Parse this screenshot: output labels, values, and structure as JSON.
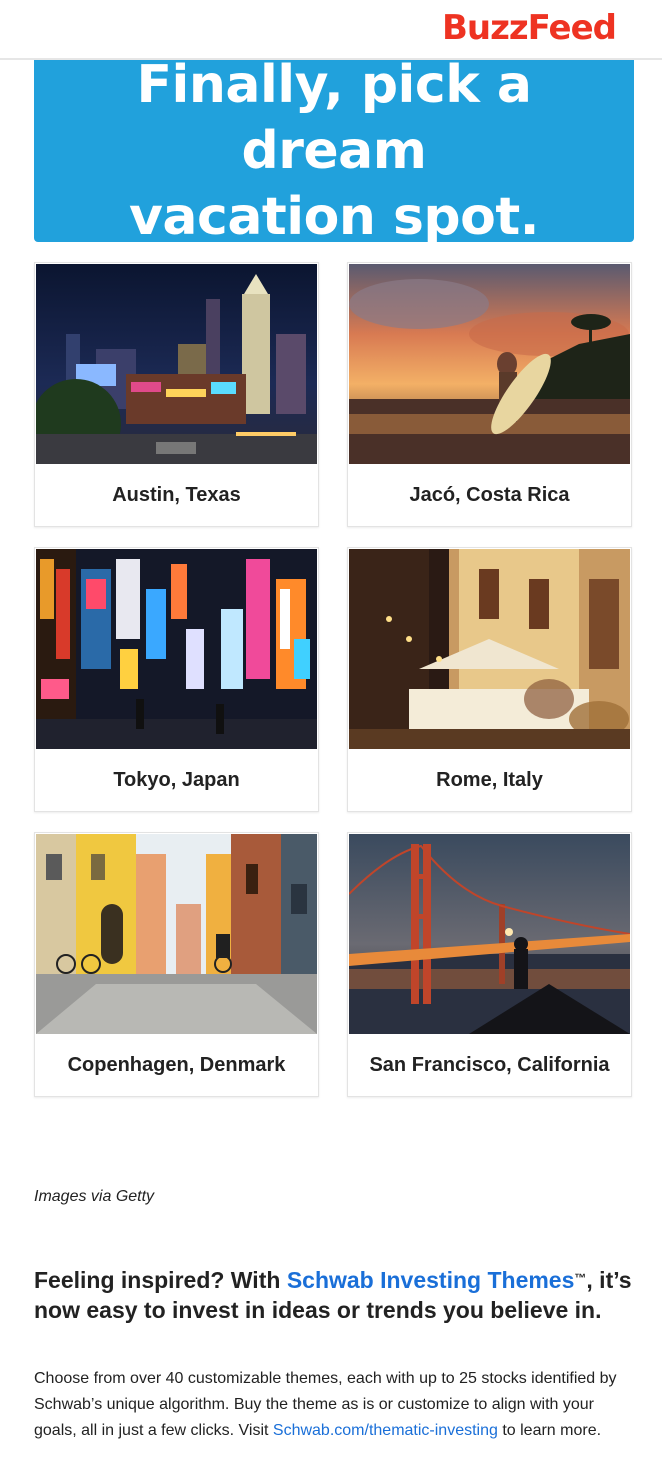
{
  "header": {
    "logo": "BuzzFeed"
  },
  "hero": {
    "title_line1": "Finally, pick a dream",
    "title_line2": "vacation spot."
  },
  "options": [
    {
      "label": "Austin, Texas"
    },
    {
      "label": "Jacó, Costa Rica"
    },
    {
      "label": "Tokyo, Japan"
    },
    {
      "label": "Rome, Italy"
    },
    {
      "label": "Copenhagen, Denmark"
    },
    {
      "label": "San Francisco, California"
    }
  ],
  "credit": "Images via Getty",
  "promo": {
    "headline_pre": "Feeling inspired? With ",
    "headline_link": "Schwab Investing Themes",
    "headline_tm": "™",
    "headline_post": ", it’s now easy to invest in ideas or trends you believe in.",
    "body_pre": "Choose from over 40 customizable themes, each with up to 25 stocks identified by Schwab’s unique algorithm. Buy the theme as is or customize to align with your goals, all in just a few clicks. Visit ",
    "body_link": "Schwab.com/thematic-investing",
    "body_post": " to learn more."
  }
}
